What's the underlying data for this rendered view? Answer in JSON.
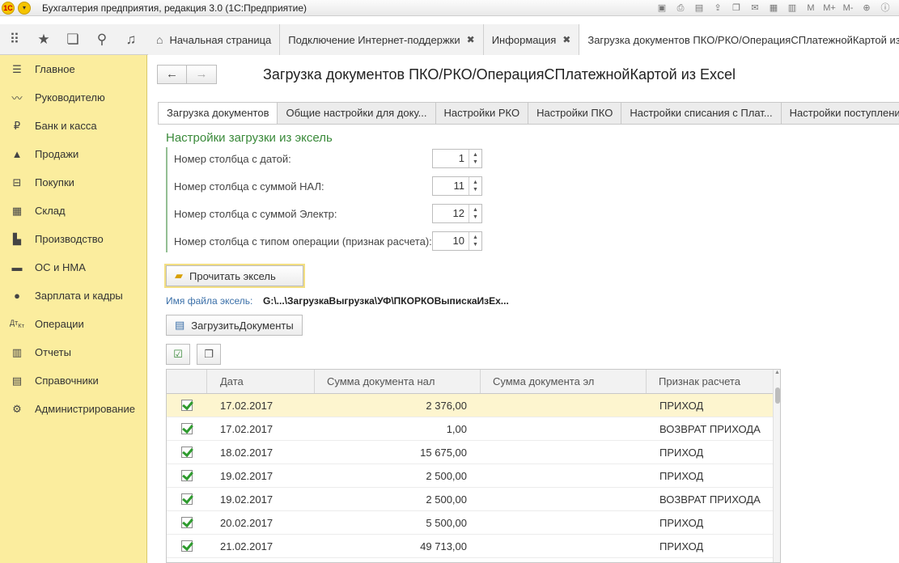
{
  "window": {
    "title": "Бухгалтерия предприятия, редакция 3.0  (1С:Предприятие)",
    "logo_text": "1С"
  },
  "tabs": [
    {
      "label": "Начальная страница",
      "closable": false
    },
    {
      "label": "Подключение Интернет-поддержки",
      "closable": true
    },
    {
      "label": "Информация",
      "closable": true
    },
    {
      "label": "Загрузка документов ПКО/РКО/ОперацияСПлатежнойКартой  из",
      "closable": false
    }
  ],
  "sidebar": {
    "items": [
      {
        "label": "Главное",
        "icon": "menu-lines-icon"
      },
      {
        "label": "Руководителю",
        "icon": "trend-icon"
      },
      {
        "label": "Банк и касса",
        "icon": "ruble-icon"
      },
      {
        "label": "Продажи",
        "icon": "bag-icon"
      },
      {
        "label": "Покупки",
        "icon": "cart-icon"
      },
      {
        "label": "Склад",
        "icon": "grid-icon"
      },
      {
        "label": "Производство",
        "icon": "factory-icon"
      },
      {
        "label": "ОС и НМА",
        "icon": "truck-icon"
      },
      {
        "label": "Зарплата и кадры",
        "icon": "person-icon"
      },
      {
        "label": "Операции",
        "icon": "dt-kt-icon"
      },
      {
        "label": "Отчеты",
        "icon": "bar-chart-icon"
      },
      {
        "label": "Справочники",
        "icon": "books-icon"
      },
      {
        "label": "Администрирование",
        "icon": "gear-icon"
      }
    ]
  },
  "form": {
    "title": "Загрузка документов ПКО/РКО/ОперацияСПлатежнойКартой  из Excel",
    "tabs": [
      {
        "label": "Загрузка документов",
        "active": true
      },
      {
        "label": "Общие настройки для доку...",
        "active": false
      },
      {
        "label": "Настройки РКО",
        "active": false
      },
      {
        "label": "Настройки ПКО",
        "active": false
      },
      {
        "label": "Настройки списания с Плат...",
        "active": false
      },
      {
        "label": "Настройки поступления",
        "active": false
      }
    ],
    "group_title": "Настройки загрузки из эксель",
    "fields": [
      {
        "label": "Номер столбца с датой:",
        "value": "1"
      },
      {
        "label": "Номер столбца с суммой НАЛ:",
        "value": "11"
      },
      {
        "label": "Номер столбца с суммой Электр:",
        "value": "12"
      },
      {
        "label": "Номер столбца с типом операции (признак расчета):",
        "value": "10"
      }
    ],
    "read_button": "Прочитать эксель",
    "file_label": "Имя файла эксель:",
    "file_value": "G:\\...\\ЗагрузкаВыгрузка\\УФ\\ПКОРКОВыпискаИзЕх...",
    "load_button": "ЗагрузитьДокументы"
  },
  "table": {
    "columns": [
      "",
      "Дата",
      "Сумма документа нал",
      "Сумма документа эл",
      "Признак расчета"
    ],
    "rows": [
      {
        "checked": true,
        "date": "17.02.2017",
        "nal": "2 376,00",
        "el": "",
        "sign": "ПРИХОД",
        "selected": true
      },
      {
        "checked": true,
        "date": "17.02.2017",
        "nal": "1,00",
        "el": "",
        "sign": "ВОЗВРАТ ПРИХОДА",
        "selected": false
      },
      {
        "checked": true,
        "date": "18.02.2017",
        "nal": "15 675,00",
        "el": "",
        "sign": "ПРИХОД",
        "selected": false
      },
      {
        "checked": true,
        "date": "19.02.2017",
        "nal": "2 500,00",
        "el": "",
        "sign": "ПРИХОД",
        "selected": false
      },
      {
        "checked": true,
        "date": "19.02.2017",
        "nal": "2 500,00",
        "el": "",
        "sign": "ВОЗВРАТ ПРИХОДА",
        "selected": false
      },
      {
        "checked": true,
        "date": "20.02.2017",
        "nal": "5 500,00",
        "el": "",
        "sign": "ПРИХОД",
        "selected": false
      },
      {
        "checked": true,
        "date": "21.02.2017",
        "nal": "49 713,00",
        "el": "",
        "sign": "ПРИХОД",
        "selected": false
      }
    ]
  },
  "colors": {
    "sidebar_bg": "#fbed9e",
    "group_green": "#3a8a3a",
    "selected_row": "#fdf5cf"
  }
}
